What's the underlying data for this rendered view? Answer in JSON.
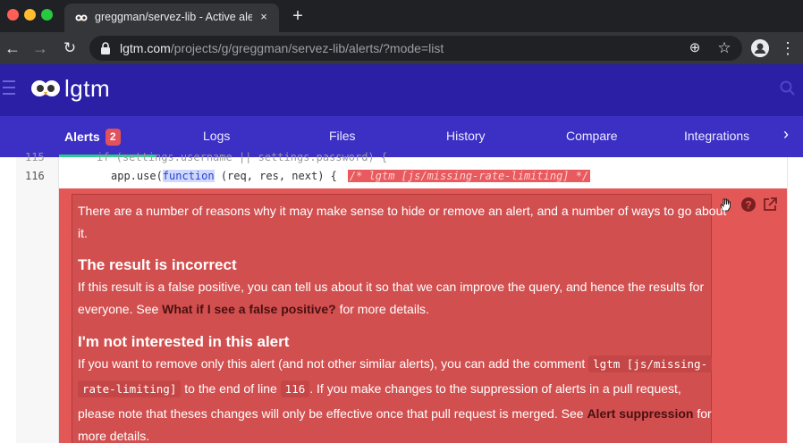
{
  "browser": {
    "tab_title": "greggman/servez-lib - Active ale",
    "tab_close": "×",
    "new_tab": "+",
    "url_host": "lgtm.com",
    "url_path": "/projects/g/greggman/servez-lib/alerts/?mode=list",
    "icons": [
      "back-arrow-icon",
      "forward-arrow-icon",
      "reload-icon",
      "lock-icon",
      "add-icon",
      "star-icon",
      "account-icon",
      "menu-icon"
    ]
  },
  "header": {
    "logo_text": "lgtm"
  },
  "subnav": {
    "items": [
      {
        "label": "Alerts",
        "badge": "2"
      },
      {
        "label": "Logs"
      },
      {
        "label": "Files"
      },
      {
        "label": "History"
      },
      {
        "label": "Compare"
      },
      {
        "label": "Integrations"
      }
    ],
    "next_arrow": "›"
  },
  "code": {
    "partial_line_number": "115",
    "partial_line_text": "if (settings.username || settings.password) {",
    "line_number": "116",
    "line_prefix": "app.use(",
    "line_keyword": "function",
    "line_rest": " (req, res, next) {",
    "line_comment": "/* lgtm [js/missing-rate-limiting] */"
  },
  "alert": {
    "intro_1": "There are a number of reasons why it may make sense to hide or remove an alert, and a number of ways to go about",
    "intro_2": "it.",
    "heading_1": "The result is incorrect",
    "p1_1": "If this result is a false positive, you can tell us about it so that we can improve the query, and hence the results for",
    "p1_2_pre": "everyone. See ",
    "p1_2_link": "What if I see a false positive?",
    "p1_2_post": " for more details.",
    "heading_2": "I'm not interested in this alert",
    "p2_1_pre": "If you want to remove only this alert (and not other similar alerts), you can add the comment ",
    "p2_1_code": "lgtm [js/missing-",
    "p2_2_code": "rate-limiting]",
    "p2_2_mid": " to the end of line ",
    "p2_2_code2": "116",
    "p2_2_post": ". If you make changes to the suppression of alerts in a pull request,",
    "p2_3_pre": "please note that theses changes will only be effective once that pull request is merged. See ",
    "p2_3_link": "Alert suppression",
    "p2_3_post": " for",
    "p2_4": "more details.",
    "icons": [
      "hand-cursor-icon",
      "help-icon",
      "external-link-icon"
    ]
  },
  "colors": {
    "header_bg": "#2b1fa6",
    "subnav_bg": "#3c2fc4",
    "badge": "#e2525d",
    "active_underline": "#2fcc8b",
    "alert_bg": "#e35757",
    "alert_box_bg": "#d24f4f"
  }
}
